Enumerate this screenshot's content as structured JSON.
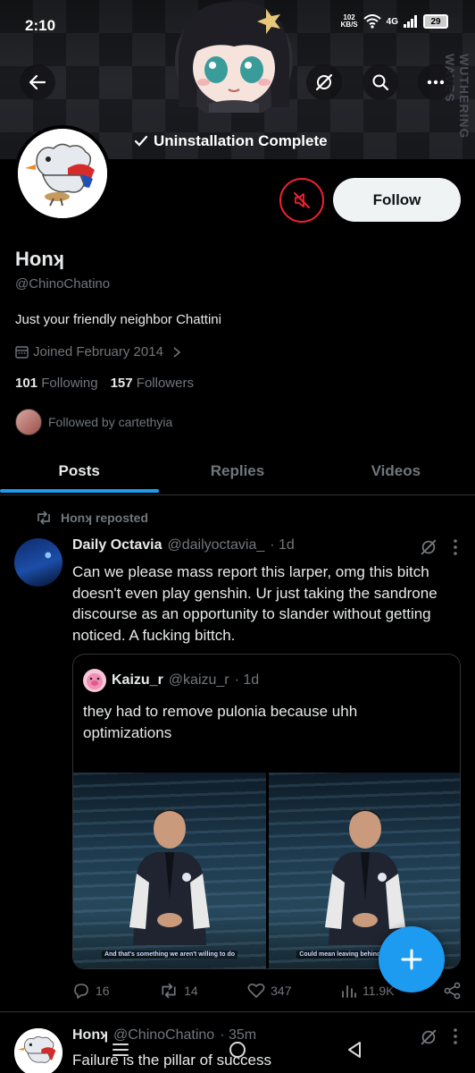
{
  "status_bar": {
    "time": "2:10",
    "net_speed_value": "102",
    "net_speed_unit": "KB/S",
    "network_type": "4G",
    "battery": "29"
  },
  "banner": {
    "side_text": "WUTHERING WAVES",
    "toast": "Uninstallation Complete"
  },
  "profile": {
    "display_name": "Honʞ",
    "handle": "@ChinoChatino",
    "bio": "Just your friendly neighbor Chattini",
    "joined": "Joined February 2014",
    "following_count": "101",
    "following_label": "Following",
    "followers_count": "157",
    "followers_label": "Followers",
    "followed_by": "Followed by carteth​yia",
    "follow_button": "Follow"
  },
  "tabs": [
    {
      "label": "Posts",
      "active": true
    },
    {
      "label": "Replies",
      "active": false
    },
    {
      "label": "Videos",
      "active": false
    }
  ],
  "post": {
    "repost_label": "Honʞ reposted",
    "author_name": "Daily Octavia",
    "author_handle": "@dailyoctavia_",
    "time": "· 1d",
    "text": "Can we please mass report this larper, omg this bitch doesn't even play genshin. Ur just taking the sandrone discourse as an opportunity to slander without getting noticed. A fucking bittch.",
    "quote": {
      "author_name": "Kaizu_r",
      "author_handle": "@kaizu_r",
      "time": "· 1d",
      "text": "they had to remove pulonia because uhh optimizations",
      "caption_left": "And that's something we aren't willing to do",
      "caption_right": "Could mean leaving behind players or                        range"
    },
    "stats": {
      "replies": "16",
      "reposts": "14",
      "likes": "347",
      "views": "11.9K"
    }
  },
  "next_post": {
    "author_name": "Honʞ",
    "author_handle": "@ChinoChatino",
    "time": "· 35m",
    "text": "Failure is the pillar of success"
  },
  "colors": {
    "accent": "#1d9bf0",
    "mute_red": "#f4212e",
    "muted_text": "#71767b",
    "text": "#e7e9ea",
    "background": "#000000"
  }
}
